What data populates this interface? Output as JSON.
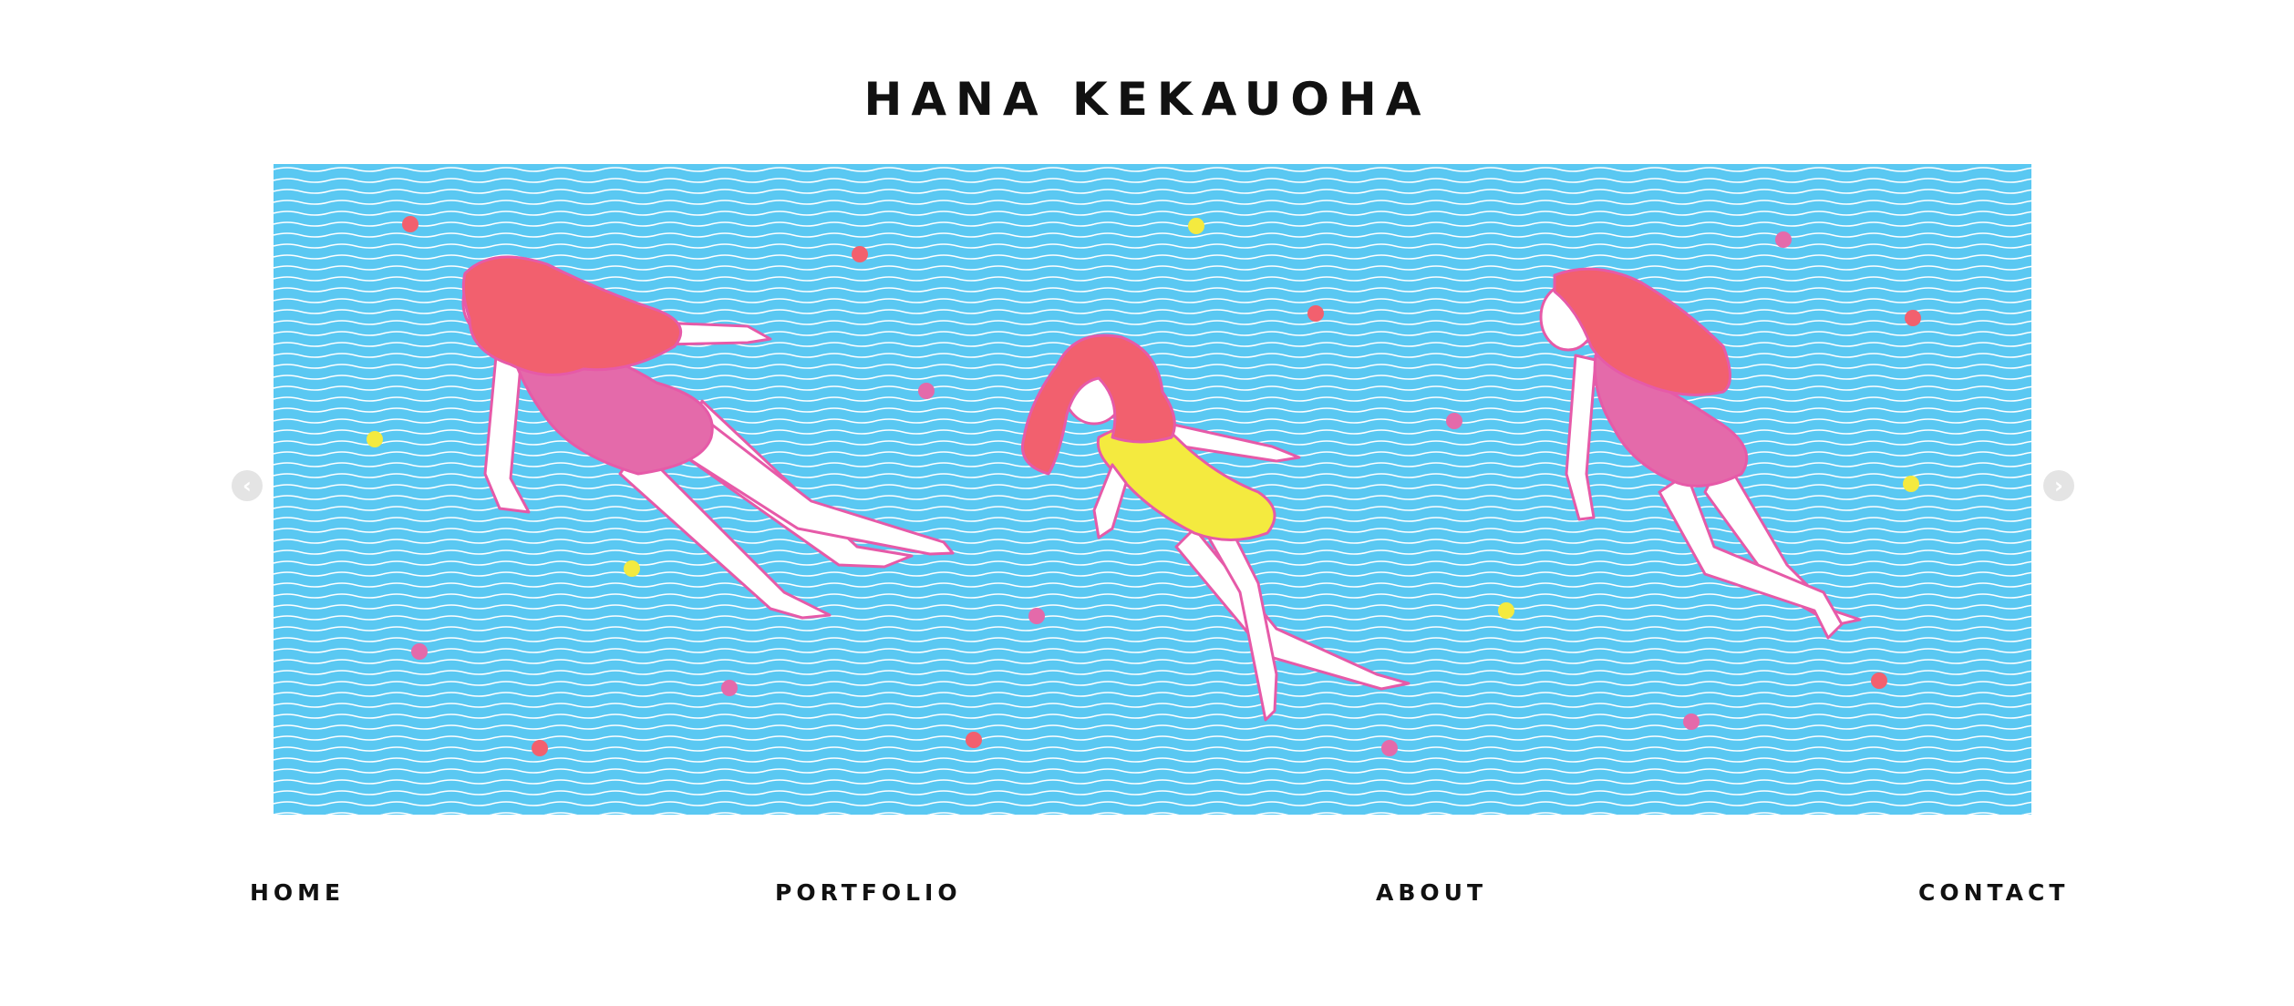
{
  "site": {
    "title": "HANA KEKAUOHA"
  },
  "slider": {
    "prev_glyph": "‹",
    "next_glyph": "›",
    "prev_icon": "chevron-left-icon",
    "next_icon": "chevron-right-icon",
    "illustration": {
      "subject": "three swimmers in water",
      "water_color": "#5ac8f2",
      "wave_color": "#ffffff",
      "hair_color": "#f2606e",
      "swimsuit_pink": "#e46aaa",
      "swimsuit_yellow": "#f4ea3f",
      "skin_color": "#ffffff",
      "outline_color": "#e65aa8"
    }
  },
  "nav": {
    "items": [
      {
        "label": "HOME"
      },
      {
        "label": "PORTFOLIO"
      },
      {
        "label": "ABOUT"
      },
      {
        "label": "CONTACT"
      }
    ]
  }
}
